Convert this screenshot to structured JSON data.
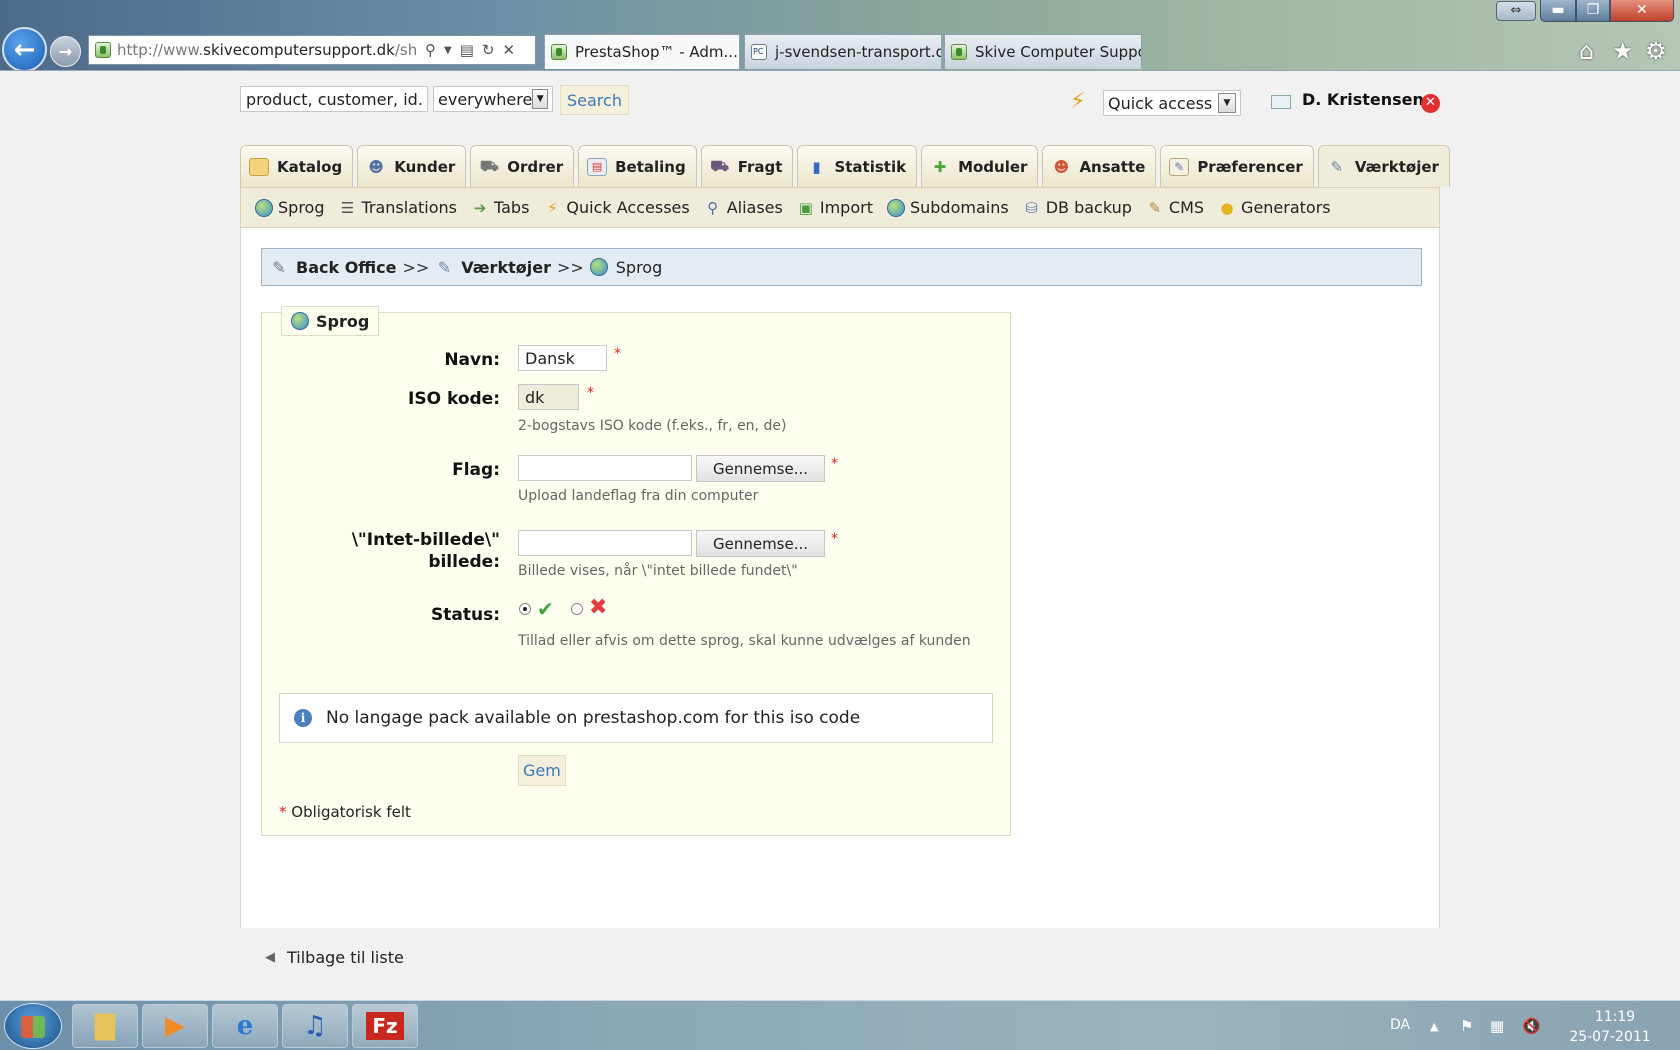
{
  "browser": {
    "url_prefix": "http://www.",
    "url_domain": "skivecomputersupport.dk",
    "url_rest": "/shopa",
    "tabs": [
      {
        "label": "PrestaShop™ - Adm..."
      },
      {
        "label": "j-svendsen-transport.dk"
      },
      {
        "label": "Skive Computer Support"
      }
    ],
    "close_glyph": "✕"
  },
  "header": {
    "search_placeholder": "product, customer, id...",
    "search_scope": "everywhere",
    "search_button": "Search",
    "quick_access": "Quick access",
    "employee_name": "D. Kristensen"
  },
  "main_tabs": [
    {
      "label": "Katalog",
      "icon": "folder-icon"
    },
    {
      "label": "Kunder",
      "icon": "customer-icon"
    },
    {
      "label": "Ordrer",
      "icon": "cart-icon"
    },
    {
      "label": "Betaling",
      "icon": "payment-icon"
    },
    {
      "label": "Fragt",
      "icon": "truck-icon"
    },
    {
      "label": "Statistik",
      "icon": "chart-icon"
    },
    {
      "label": "Moduler",
      "icon": "puzzle-icon"
    },
    {
      "label": "Ansatte",
      "icon": "employee-icon"
    },
    {
      "label": "Præferencer",
      "icon": "preferences-icon"
    },
    {
      "label": "Værktøjer",
      "icon": "wrench-icon",
      "active": true
    }
  ],
  "sub_tabs": [
    {
      "label": "Sprog",
      "icon": "globe-icon"
    },
    {
      "label": "Translations",
      "icon": "translations-icon"
    },
    {
      "label": "Tabs",
      "icon": "tabs-icon"
    },
    {
      "label": "Quick Accesses",
      "icon": "bolt-icon"
    },
    {
      "label": "Aliases",
      "icon": "magnifier-icon"
    },
    {
      "label": "Import",
      "icon": "import-icon"
    },
    {
      "label": "Subdomains",
      "icon": "globe-icon"
    },
    {
      "label": "DB backup",
      "icon": "database-icon"
    },
    {
      "label": "CMS",
      "icon": "cms-icon"
    },
    {
      "label": "Generators",
      "icon": "lightbulb-icon"
    }
  ],
  "breadcrumb": {
    "root": "Back Office",
    "section": "Værktøjer",
    "current": "Sprog",
    "separator": ">>"
  },
  "form": {
    "legend": "Sprog",
    "name_label": "Navn:",
    "name_value": "Dansk",
    "iso_label": "ISO kode:",
    "iso_value": "dk",
    "iso_hint": "2-bogstavs ISO kode (f.eks., fr, en, de)",
    "flag_label": "Flag:",
    "flag_browse": "Gennemse...",
    "flag_hint": "Upload landeflag fra din computer",
    "noimage_label_1": "\\\"Intet-billede\\\"",
    "noimage_label_2": "billede:",
    "noimage_browse": "Gennemse...",
    "noimage_hint": "Billede vises, når \\\"intet billede fundet\\\"",
    "status_label": "Status:",
    "status_enabled": true,
    "status_hint": "Tillad eller afvis om dette sprog, skal kunne udvælges af kunden",
    "required_mark": "*",
    "info_message": "No langage pack available on prestashop.com for this iso code",
    "save_button": "Gem",
    "required_note": "Obligatorisk felt"
  },
  "back_link": "Tilbage til liste",
  "taskbar": {
    "language": "DA",
    "time": "11:19",
    "date": "25-07-2011"
  },
  "colors": {
    "panel_bg": "#fffff0",
    "tab_bg": "#efecdc",
    "link_blue": "#3a79b5",
    "required_red": "#d22222"
  }
}
